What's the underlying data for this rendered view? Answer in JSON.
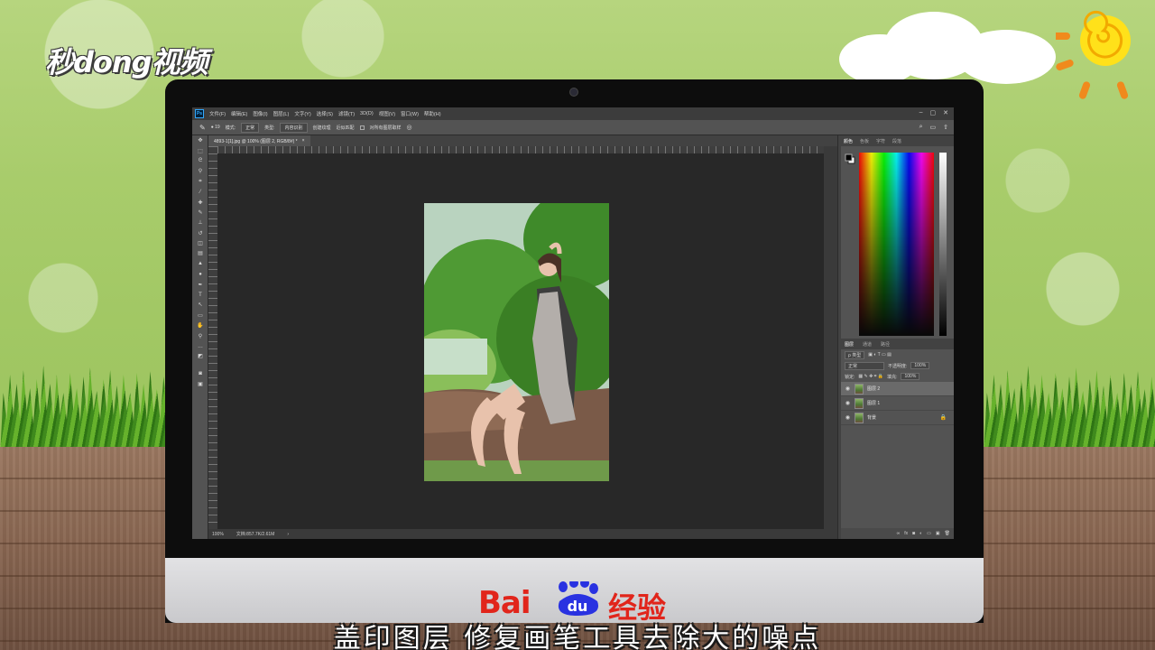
{
  "branding": {
    "logo": "秒dong视频",
    "baidu_bai": "Bai",
    "baidu_du": "du",
    "baidu_jingyan": "经验"
  },
  "subtitle": "盖印图层  修复画笔工具去除大的噪点",
  "photoshop": {
    "app_icon": "Ps",
    "menu": [
      "文件(F)",
      "编辑(E)",
      "图像(I)",
      "图层(L)",
      "文字(Y)",
      "选择(S)",
      "滤镜(T)",
      "3D(D)",
      "视图(V)",
      "窗口(W)",
      "帮助(H)"
    ],
    "window_controls": [
      "–",
      "▢",
      "✕"
    ],
    "options": {
      "brush_size": "19",
      "mode_label": "模式:",
      "mode_value": "正常",
      "type_label": "类型:",
      "btn_content_aware": "内容识别",
      "btn_create_texture": "创建纹理",
      "btn_proximity": "近似匹配",
      "sample_all_layers": "对所有图层取样"
    },
    "document_tab": "4893-1[1].jpg @ 100% (图层 2, RGB/8#) *",
    "status": {
      "zoom": "100%",
      "doc_size": "文档:857.7K/2.61M"
    },
    "color_panel": {
      "tabs": [
        "颜色",
        "色板",
        "字符",
        "段落"
      ],
      "active_tab": "颜色"
    },
    "layers_panel": {
      "tabs": [
        "图层",
        "通道",
        "路径"
      ],
      "active_tab": "图层",
      "filter_label": "ρ 类型",
      "blend_mode": "正常",
      "opacity_label": "不透明度:",
      "opacity_value": "100%",
      "lock_label": "锁定:",
      "fill_label": "填充:",
      "fill_value": "100%",
      "layers": [
        {
          "name": "图层 2",
          "selected": true,
          "locked": false
        },
        {
          "name": "图层 1",
          "selected": false,
          "locked": false
        },
        {
          "name": "背景",
          "selected": false,
          "locked": true
        }
      ]
    }
  },
  "colors": {
    "ps_dark": "#282828",
    "ps_panel": "#535353",
    "baidu_red": "#e1251b",
    "baidu_blue": "#2932e1"
  }
}
